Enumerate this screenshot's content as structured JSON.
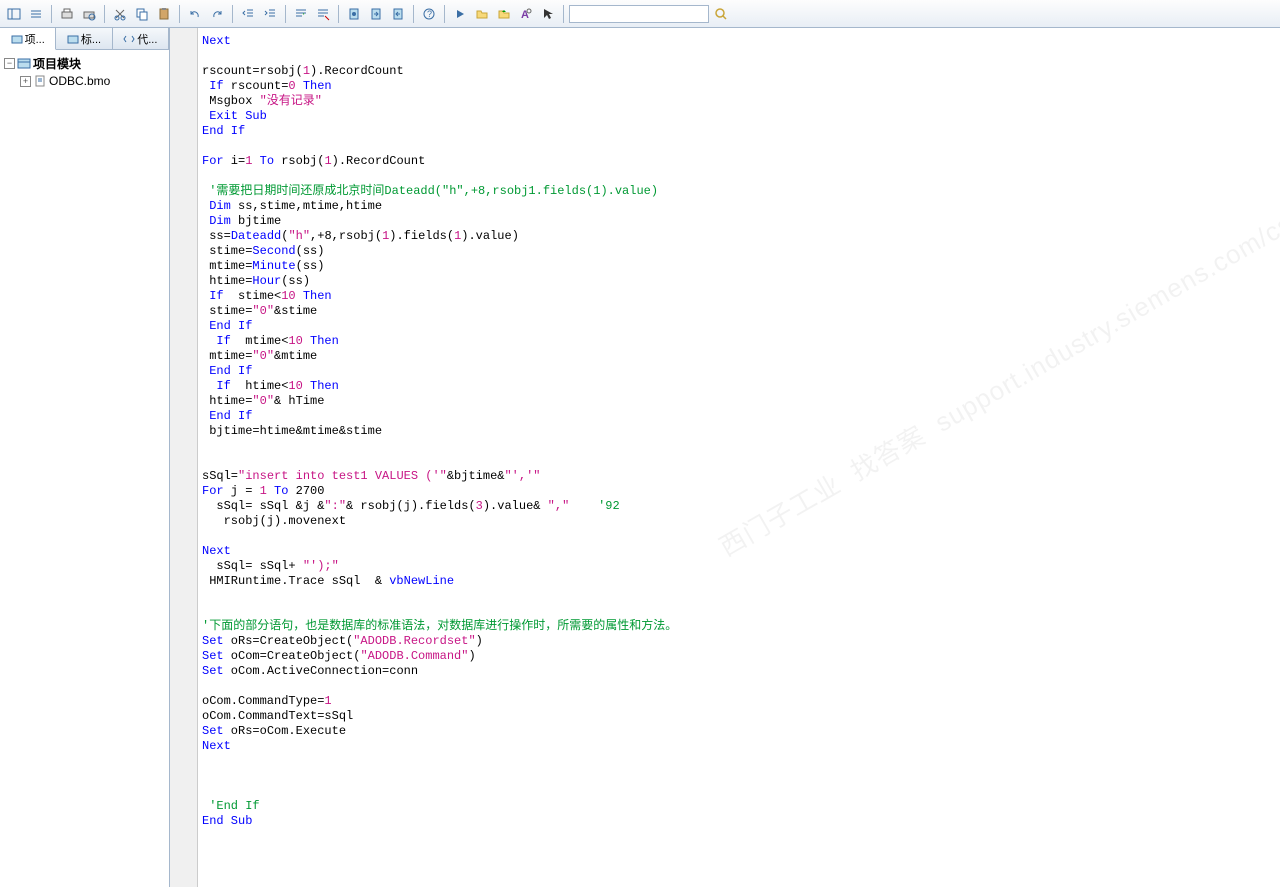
{
  "toolbar": {
    "search_value": ""
  },
  "tabs": [
    {
      "label": "项..."
    },
    {
      "label": "标..."
    },
    {
      "label": "代..."
    }
  ],
  "tree": {
    "root": "项目模块",
    "item1": "ODBC.bmo"
  },
  "code": {
    "line1_next": "Next",
    "line3_rscount": "rscount=rsobj(",
    "line3_one": "1",
    "line3_rec": ").RecordCount",
    "line4_if": " If",
    "line4_cond": " rscount=",
    "line4_zero": "0",
    "line4_then": " Then",
    "line5_msgbox": " Msgbox ",
    "line5_str": "\"没有记录\"",
    "line6_exit": " Exit Sub",
    "line7_endif": "End If",
    "line9_for": "For",
    "line9_i": " i=",
    "line9_one": "1",
    "line9_to": " To",
    "line9_rs": " rsobj(",
    "line9_one2": "1",
    "line9_rec": ").RecordCount",
    "line11_cmt": " '需要把日期时间还原成北京时间Dateadd(\"h\",+8,rsobj1.fields(1).value)",
    "line12_dim": " Dim",
    "line12_vars": " ss,stime,mtime,htime",
    "line13_dim": " Dim",
    "line13_var": " bjtime",
    "line14_ss": " ss=",
    "line14_da": "Dateadd",
    "line14_args": "(",
    "line14_h": "\"h\"",
    "line14_c1": ",+8,rsobj(",
    "line14_one": "1",
    "line14_c2": ").fields(",
    "line14_one2": "1",
    "line14_c3": ").value)",
    "line15_st": " stime=",
    "line15_sec": "Second",
    "line15_ss": "(ss)",
    "line16_mt": " mtime=",
    "line16_min": "Minute",
    "line16_ss": "(ss)",
    "line17_ht": " htime=",
    "line17_hr": "Hour",
    "line17_ss": "(ss)",
    "line18_if": " If",
    "line18_cond": "  stime<",
    "line18_ten": "10",
    "line18_then": " Then",
    "line19_st": " stime=",
    "line19_z": "\"0\"",
    "line19_amp": "&stime",
    "line20_endif": " End If",
    "line21_if": "  If",
    "line21_cond": "  mtime<",
    "line21_ten": "10",
    "line21_then": " Then",
    "line22_mt": " mtime=",
    "line22_z": "\"0\"",
    "line22_amp": "&mtime",
    "line23_endif": " End If",
    "line24_if": "  If",
    "line24_cond": "  htime<",
    "line24_ten": "10",
    "line24_then": " Then",
    "line25_ht": " htime=",
    "line25_z": "\"0\"",
    "line25_amp": "& hTime",
    "line26_endif": " End If",
    "line27_bj": " bjtime=htime&mtime&stime",
    "line30_sql": "sSql=",
    "line30_str": "\"insert into test1 VALUES ('\"",
    "line30_mid": "&bjtime&",
    "line30_str2": "\"','\"",
    "line31_for": "For",
    "line31_j": " j = ",
    "line31_one": "1",
    "line31_to": " To",
    "line31_n": " 2700",
    "line32_sql": "  sSql= sSql &j &",
    "line32_colon": "\":\"",
    "line32_mid": "& rsobj(j).fields(",
    "line32_three": "3",
    "line32_end": ").value& ",
    "line32_comma": "\",\"",
    "line32_cmt": "    '92",
    "line33_mn": "   rsobj(j).movenext",
    "line35_next": "Next",
    "line36_sql": "  sSql= sSql+ ",
    "line36_str": "\"');\"",
    "line37_tr": " HMIRuntime.Trace sSql  & ",
    "line37_vbnl": "vbNewLine",
    "line40_cmt": "'下面的部分语句，也是数据库的标准语法，对数据库进行操作时，所需要的属性和方法。",
    "line41_set": "Set",
    "line41_ors": " oRs=CreateObject(",
    "line41_str": "\"ADODB.Recordset\"",
    "line41_end": ")",
    "line42_set": "Set",
    "line42_ocom": " oCom=CreateObject(",
    "line42_str": "\"ADODB.Command\"",
    "line42_end": ")",
    "line43_set": "Set",
    "line43_ac": " oCom.ActiveConnection=conn",
    "line45_ct": "oCom.CommandType=",
    "line45_one": "1",
    "line46_ctx": "oCom.CommandText=sSql",
    "line47_set": "Set",
    "line47_exec": " oRs=oCom.Execute",
    "line48_next": "Next",
    "line52_cmt": " 'End If",
    "line53_endsub": "End Sub"
  },
  "watermark": "西门子工业  找答案  support.industry.siemens.com/cs"
}
